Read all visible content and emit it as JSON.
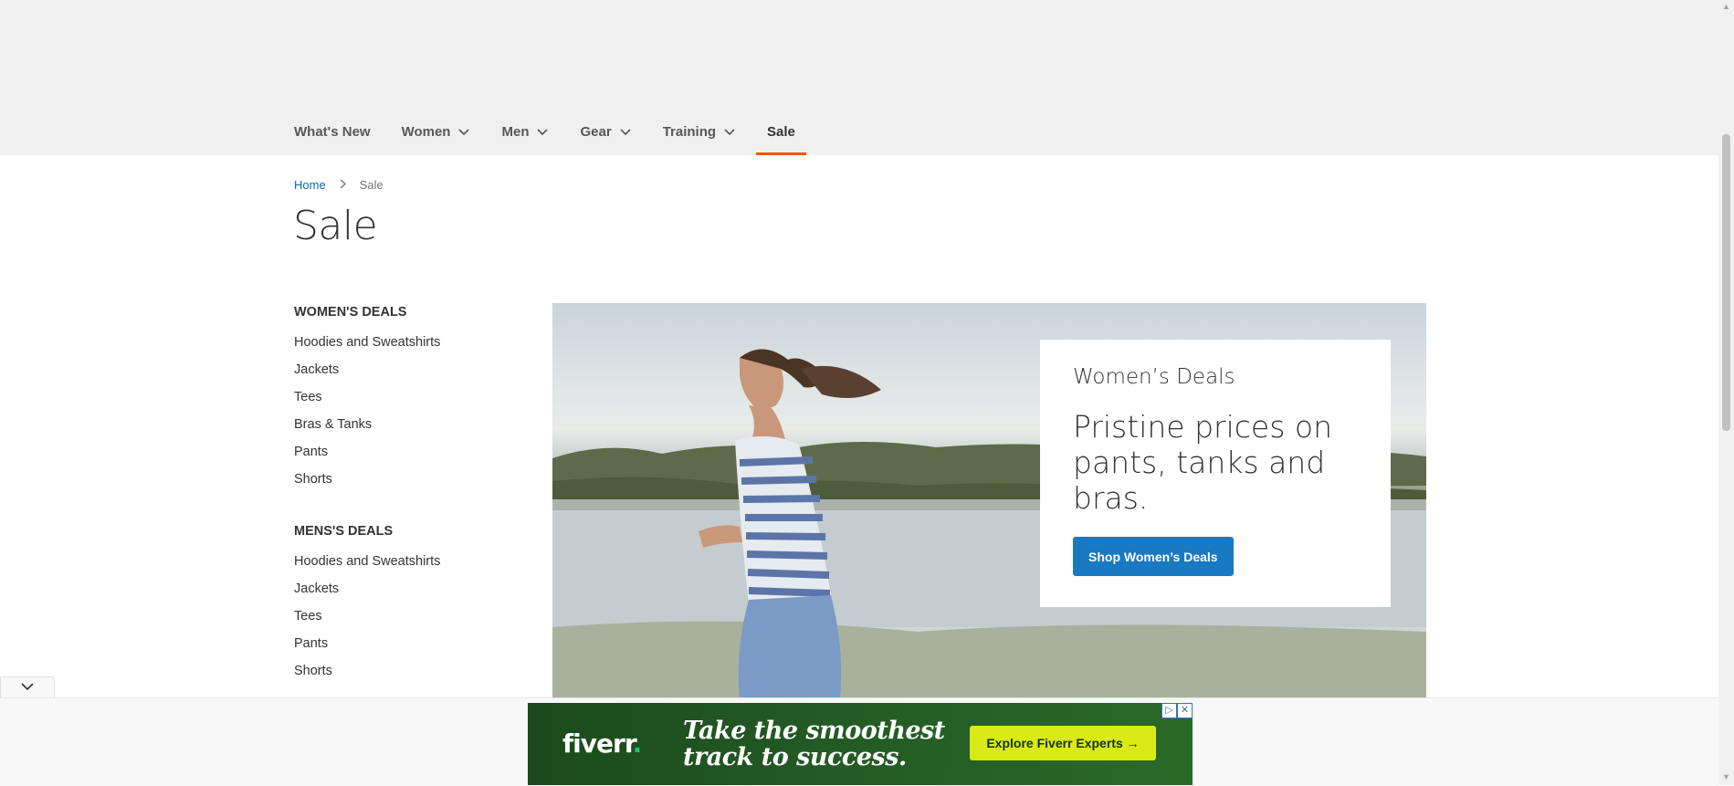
{
  "nav": {
    "items": [
      {
        "label": "What's New",
        "has_dropdown": false,
        "active": false
      },
      {
        "label": "Women",
        "has_dropdown": true,
        "active": false
      },
      {
        "label": "Men",
        "has_dropdown": true,
        "active": false
      },
      {
        "label": "Gear",
        "has_dropdown": true,
        "active": false
      },
      {
        "label": "Training",
        "has_dropdown": true,
        "active": false
      },
      {
        "label": "Sale",
        "has_dropdown": false,
        "active": true
      }
    ],
    "active_color": "#ff5501"
  },
  "breadcrumb": {
    "home": "Home",
    "current": "Sale"
  },
  "page_title": "Sale",
  "sidebar": {
    "groups": [
      {
        "heading": "WOMEN'S DEALS",
        "links": [
          "Hoodies and Sweatshirts",
          "Jackets",
          "Tees",
          "Bras & Tanks",
          "Pants",
          "Shorts"
        ]
      },
      {
        "heading": "MENS'S DEALS",
        "links": [
          "Hoodies and Sweatshirts",
          "Jackets",
          "Tees",
          "Pants",
          "Shorts"
        ]
      }
    ]
  },
  "hero": {
    "kicker": "Women’s Deals",
    "title": "Pristine prices on pants, tanks and bras.",
    "button_label": "Shop Women’s Deals",
    "button_color": "#1979c3"
  },
  "ad": {
    "logo": "fiverr",
    "logo_dot": ".",
    "headline_line1": "Take the smoothest",
    "headline_line2": "track to success.",
    "cta": "Explore Fiverr Experts →",
    "badge_adchoices_icon": "adchoices-icon",
    "badge_close_icon": "close-icon",
    "cta_color": "#d9ea14"
  },
  "ad_toggle_icon": "chevron-down-icon"
}
